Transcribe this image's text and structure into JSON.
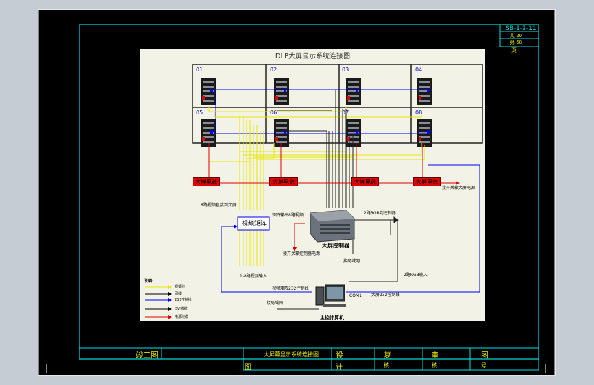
{
  "sheet": {
    "code": "SB-1-2-11",
    "sheet_total_label": "共 20",
    "sheet_no_label": "第 68",
    "page_label": "页"
  },
  "title_block": {
    "type": "竣工图",
    "drawing_name": "大屏幕显示系统连接图",
    "design_top": "设",
    "design_bottom": "计",
    "review_top": "复",
    "review_bottom": "核",
    "audit_top": "审",
    "audit_bottom": "核",
    "drawing_no_top": "图",
    "drawing_no_bottom": "号",
    "name_bottom": "图"
  },
  "diagram": {
    "title": "DLP大屏显示系统连接图",
    "cells": [
      "01",
      "02",
      "03",
      "04",
      "05",
      "06",
      "07",
      "08"
    ],
    "psu_label": "大屏电源",
    "psu_note": "接开关箱大屏电源",
    "matrix_label": "视频矩阵",
    "controller_label": "大屏控制器",
    "computer_label": "主控计算机",
    "notes": {
      "direct_video": "8路视频直接到大屏",
      "matrix_out": "矩阵输出8路视频",
      "rgb_ctrl": "2路RGB到控制器",
      "ctrl_power": "接开关箱控制器电源",
      "lan_ctrl": "接局域网",
      "rgb_in": "2路RGB输入",
      "video_in": "1-8路视频输入",
      "matrix_232": "视频矩阵232控制线",
      "com1": "COM1",
      "screen_232": "大屏232控制线",
      "lan_pc": "接局域网"
    },
    "legend": {
      "heading": "说明:",
      "items": [
        {
          "label": "视频线",
          "color": "#e8e800"
        },
        {
          "label": "网线",
          "color": "#000000"
        },
        {
          "label": "232控制线",
          "color": "#0000ff"
        },
        {
          "label": "DVI线缆",
          "color": "#000000"
        },
        {
          "label": "电源线缆",
          "color": "#e00000"
        }
      ]
    }
  }
}
